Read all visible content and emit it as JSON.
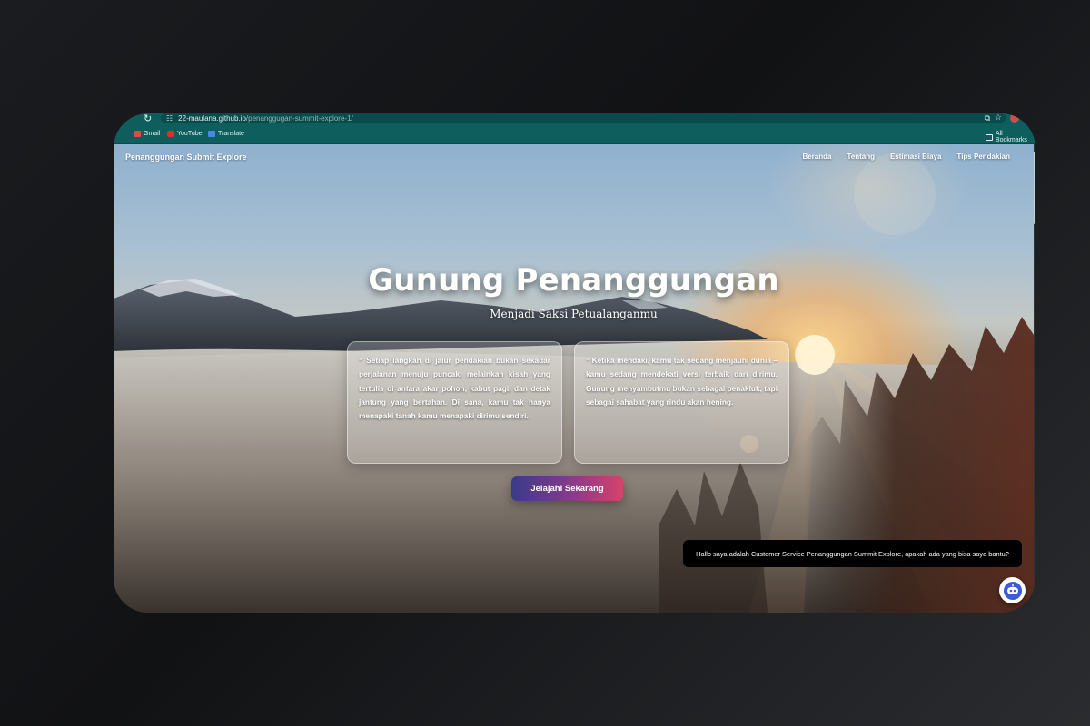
{
  "browser": {
    "url_host": "22-maulana.github.io",
    "url_path": "/penanggugan-summit-explore-1/",
    "bookmarks": [
      {
        "label": "Gmail",
        "icon": "gmail-icon"
      },
      {
        "label": "YouTube",
        "icon": "youtube-icon"
      },
      {
        "label": "Translate",
        "icon": "translate-icon"
      }
    ],
    "all_bookmarks": "All Bookmarks"
  },
  "header": {
    "brand": "Penanggungan Submit Explore",
    "nav": [
      "Beranda",
      "Tentang",
      "Estimasi Biaya",
      "Tips Pendakian"
    ]
  },
  "hero": {
    "title": "Gunung Penanggungan",
    "subtitle": "Menjadi Saksi Petualanganmu",
    "quotes": [
      "“ Setiap langkah di jalur pendakian bukan sekadar perjalanan menuju puncak, melainkan kisah yang tertulis di antara akar pohon, kabut pagi, dan detak jantung yang bertahan. Di sana, kamu tak hanya menapaki tanah kamu menapaki dirimu sendiri.",
      "“ Ketika mendaki, kamu tak sedang menjauhi dunia – kamu sedang mendekati versi terbaik dari dirimu. Gunung menyambutmu bukan sebagai penakluk, tapi sebagai sahabat yang rindu akan hening."
    ],
    "cta": "Jelajahi Sekarang"
  },
  "chat": {
    "message": "Hallo saya adalah Customer Service Penanggungan Summit Explore, apakah ada yang bisa saya bantu?",
    "button_icon": "chatbot-icon"
  },
  "colors": {
    "chrome": "#0e5e5e",
    "cta_start": "#3a3a8a",
    "cta_end": "#d8426a"
  }
}
